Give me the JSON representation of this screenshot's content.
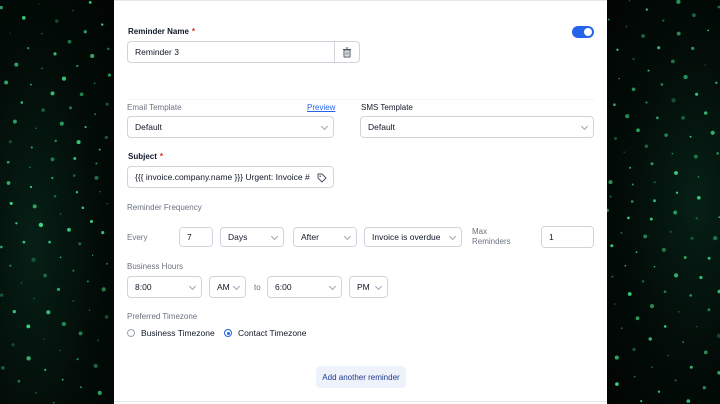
{
  "reminder": {
    "name_label": "Reminder Name",
    "required_mark": "*",
    "name_value": "Reminder 3",
    "delete_icon": "trash-icon",
    "enabled": true
  },
  "email_template": {
    "label": "Email Template",
    "preview_link": "Preview",
    "value": "Default"
  },
  "sms_template": {
    "label": "SMS Template",
    "value": "Default"
  },
  "subject": {
    "label": "Subject",
    "required_mark": "*",
    "value": "{{{ invoice.company.name }}} Urgent: Invoice #",
    "tag_icon": "tag-icon"
  },
  "frequency": {
    "label": "Reminder Frequency",
    "every_label": "Every",
    "count": "7",
    "unit": "Days",
    "timing": "After",
    "trigger": "Invoice is overdue",
    "max_label_line1": "Max",
    "max_label_line2": "Reminders",
    "max_value": "1"
  },
  "business_hours": {
    "label": "Business Hours",
    "start_time": "8:00",
    "start_period": "AM",
    "to_label": "to",
    "end_time": "6:00",
    "end_period": "PM"
  },
  "timezone": {
    "label": "Preferred Timezone",
    "options": [
      {
        "label": "Business Timezone",
        "selected": false
      },
      {
        "label": "Contact Timezone",
        "selected": true
      }
    ]
  },
  "actions": {
    "add_reminder": "Add another reminder"
  },
  "colors": {
    "accent": "#2563eb",
    "required": "#dc2626",
    "background_glow": "#3fe08a"
  }
}
